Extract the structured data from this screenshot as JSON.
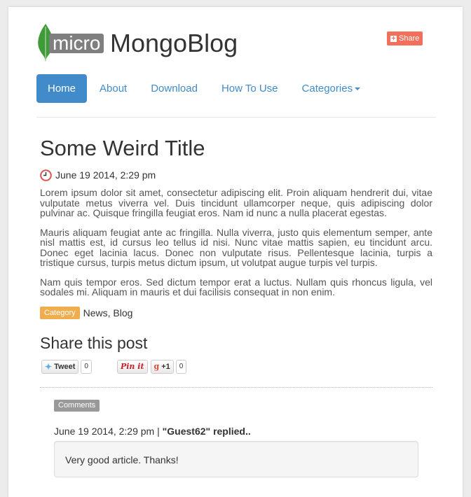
{
  "brand": {
    "micro": "micro",
    "name": "MongoBlog",
    "share_label": "Share",
    "share_color": "#f26f5b",
    "leaf_color": "#3f9b3a"
  },
  "nav": {
    "items": [
      {
        "label": "Home",
        "active": true
      },
      {
        "label": "About"
      },
      {
        "label": "Download"
      },
      {
        "label": "How To Use"
      },
      {
        "label": "Categories",
        "dropdown": true
      }
    ],
    "accent": "#428bca"
  },
  "post": {
    "title": "Some Weird Title",
    "date": "June 19 2014, 2:29 pm",
    "paragraphs": [
      "Lorem ipsum dolor sit amet, consectetur adipiscing elit. Proin aliquam hendrerit dui, vitae vulputate metus viverra vel. Duis tincidunt ullamcorper neque, quis adipiscing dolor pulvinar ac. Quisque fringilla feugiat eros. Nam id nunc a nulla placerat egestas.",
      "Mauris aliquam feugiat ante ac fringilla. Nulla viverra, justo quis elementum semper, ante nisl mattis est, id cursus leo tellus id nisi. Nunc vitae mattis sapien, eu tincidunt arcu. Donec eget lacinia lacus. Donec non vulputate risus. Pellentesque lacinia, turpis a tristique cursus, turpis metus dictum ipsum, ut volutpat augue turpis vel turpis.",
      "Nam quis tempor eros. Sed dictum tempor erat a luctus. Nullam quis rhoncus ligula, vel sodales mi. Aliquam in mauris et dui facilisis consequat in non enim."
    ],
    "category_label": "Category",
    "categories": "News, Blog"
  },
  "share": {
    "heading": "Share this post",
    "tweet_label": "Tweet",
    "tweet_count": "0",
    "pin_label": "Pin it",
    "gplus_label": "+1",
    "gplus_count": "0"
  },
  "comments": {
    "badge": "Comments",
    "items": [
      {
        "date": "June 19 2014, 2:29 pm",
        "separator": "|",
        "author_line": "\"Guest62\" replied..",
        "text": "Very good article. Thanks!"
      }
    ]
  }
}
